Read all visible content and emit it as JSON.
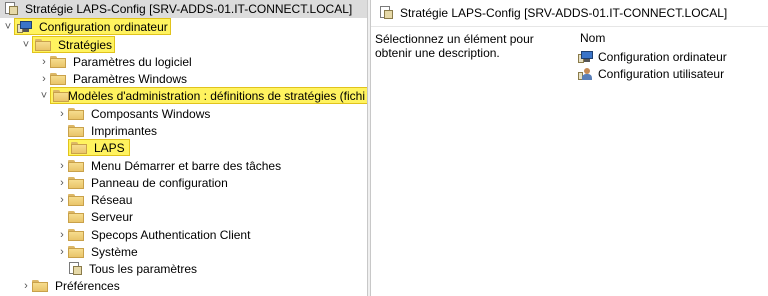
{
  "tree": {
    "root": {
      "label": "Stratégie LAPS-Config [SRV-ADDS-01.IT-CONNECT.LOCAL]",
      "icon": "policy-doc-icon"
    },
    "items": [
      {
        "label": "Configuration ordinateur",
        "icon": "computer-policy-icon",
        "arrow": "˅",
        "highlight": true
      },
      {
        "label": "Stratégies",
        "icon": "folder-icon",
        "arrow": "˅",
        "highlight": true
      },
      {
        "label": "Paramètres du logiciel",
        "icon": "folder-icon",
        "arrow": "›",
        "highlight": false
      },
      {
        "label": "Paramètres Windows",
        "icon": "folder-icon",
        "arrow": "›",
        "highlight": false
      },
      {
        "label": "Modèles d'administration : définitions de stratégies (fichi",
        "icon": "folder-icon",
        "arrow": "˅",
        "highlight": true
      },
      {
        "label": "Composants Windows",
        "icon": "folder-icon",
        "arrow": "›",
        "highlight": false
      },
      {
        "label": "Imprimantes",
        "icon": "folder-icon",
        "arrow": "",
        "highlight": false
      },
      {
        "label": "LAPS",
        "icon": "folder-icon",
        "arrow": "",
        "highlight": true
      },
      {
        "label": "Menu Démarrer et barre des tâches",
        "icon": "folder-icon",
        "arrow": "›",
        "highlight": false
      },
      {
        "label": "Panneau de configuration",
        "icon": "folder-icon",
        "arrow": "›",
        "highlight": false
      },
      {
        "label": "Réseau",
        "icon": "folder-icon",
        "arrow": "›",
        "highlight": false
      },
      {
        "label": "Serveur",
        "icon": "folder-icon",
        "arrow": "",
        "highlight": false
      },
      {
        "label": "Specops Authentication Client",
        "icon": "folder-icon",
        "arrow": "›",
        "highlight": false
      },
      {
        "label": "Système",
        "icon": "folder-icon",
        "arrow": "›",
        "highlight": false
      },
      {
        "label": "Tous les paramètres",
        "icon": "all-settings-icon",
        "arrow": "",
        "highlight": false
      },
      {
        "label": "Préférences",
        "icon": "folder-icon",
        "arrow": "›",
        "highlight": false
      }
    ]
  },
  "details": {
    "title": "Stratégie LAPS-Config [SRV-ADDS-01.IT-CONNECT.LOCAL]",
    "description": "Sélectionnez un élément pour obtenir une description.",
    "column_header": "Nom",
    "items": [
      {
        "label": "Configuration ordinateur",
        "icon": "computer-policy-icon"
      },
      {
        "label": "Configuration utilisateur",
        "icon": "user-policy-icon"
      }
    ]
  },
  "colors": {
    "highlight": "#fff35f",
    "selection": "#dcdcdc"
  }
}
